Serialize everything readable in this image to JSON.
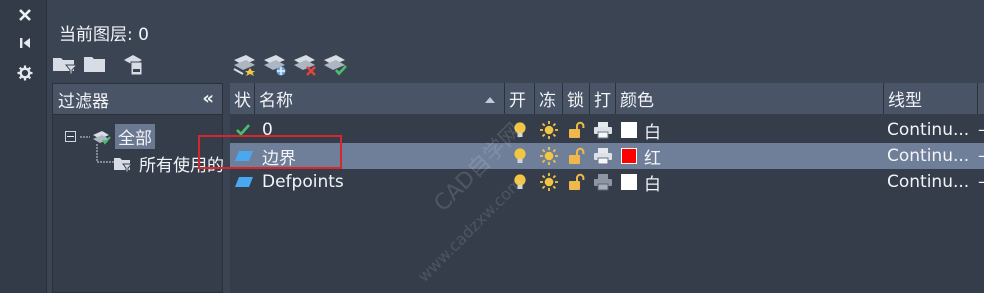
{
  "side": {
    "close": "✕",
    "pin": "⏮",
    "settings": "⚙"
  },
  "header": {
    "current_layer_label": "当前图层:",
    "current_layer_value": "0"
  },
  "filter_panel": {
    "title": "过滤器",
    "collapse": "«",
    "all_label": "全部",
    "used_label": "所有使用的"
  },
  "columns": [
    "状",
    "名称",
    "开",
    "冻",
    "锁",
    "打",
    "颜色",
    "线型"
  ],
  "layers": [
    {
      "status": "✓",
      "name": "0",
      "color_name": "白",
      "color_hex": "#ffffff",
      "linetype": "Continu...",
      "trail": "—"
    },
    {
      "status": "▱",
      "name": "边界",
      "color_name": "红",
      "color_hex": "#ff0000",
      "linetype": "Continu...",
      "trail": "—"
    },
    {
      "status": "▱",
      "name": "Defpoints",
      "color_name": "白",
      "color_hex": "#ffffff",
      "linetype": "Continu...",
      "trail": "—"
    }
  ],
  "watermark": {
    "line1": "CAD自学网",
    "line2": "www.cadzxw.com"
  },
  "colors": {
    "accent_red": "#d8262a",
    "selected_row": "#6f7e99",
    "bulb": "#f3c545",
    "lock": "#f0b84a"
  }
}
